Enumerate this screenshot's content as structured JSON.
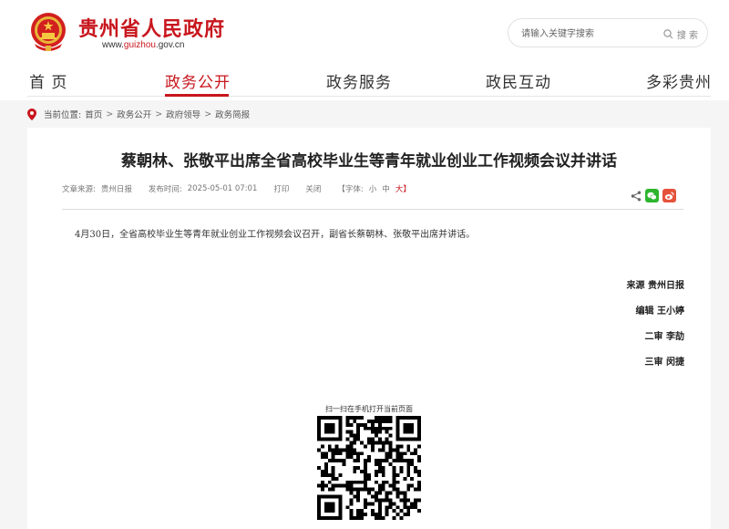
{
  "header": {
    "site_name": "贵州省人民政府",
    "site_url_prefix": "www.",
    "site_url_highlight": "guizhou",
    "site_url_suffix": ".gov.cn",
    "search_placeholder": "请输入关键字搜索",
    "search_button": "搜 索"
  },
  "nav": {
    "items": [
      "首 页",
      "政务公开",
      "政务服务",
      "政民互动",
      "多彩贵州"
    ],
    "active_index": 1
  },
  "breadcrumb": {
    "label": "当前位置:",
    "items": [
      "首页",
      "政务公开",
      "政府领导",
      "政务简报"
    ]
  },
  "article": {
    "title": "蔡朝林、张敬平出席全省高校毕业生等青年就业创业工作视频会议并讲话",
    "source_label": "文章来源:",
    "source": "贵州日报",
    "date_label": "发布时间:",
    "date": "2025-05-01 07:01",
    "print": "打印",
    "close": "关闭",
    "font_label": "【字体:",
    "font_small": "小",
    "font_medium": "中",
    "font_large": "大】",
    "body": "4月30日，全省高校毕业生等青年就业创业工作视频会议召开，副省长蔡朝林、张敬平出席并讲话。",
    "signatures": [
      "来源  贵州日报",
      "编辑  王小婷",
      "二审  李劼",
      "三审  闵捷"
    ],
    "qr_label": "扫一扫在手机打开当前页面"
  },
  "colors": {
    "brand_red": "#c8161d",
    "wechat_green": "#2eb52e",
    "weibo_red": "#e5523b"
  }
}
